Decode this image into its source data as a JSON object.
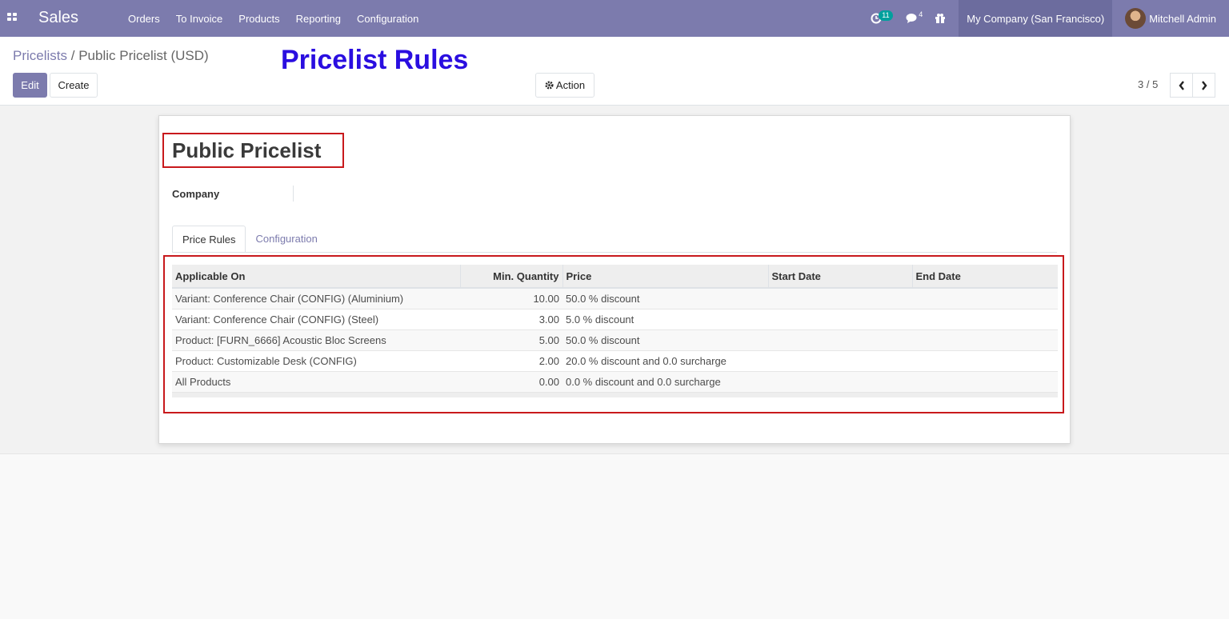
{
  "app": {
    "name": "Sales"
  },
  "menu": [
    "Orders",
    "To Invoice",
    "Products",
    "Reporting",
    "Configuration"
  ],
  "systray": {
    "activity_count": "11",
    "messages_count": "4",
    "company": "My Company (San Francisco)",
    "user": "Mitchell Admin"
  },
  "breadcrumb": {
    "parent": "Pricelists",
    "separator": "/",
    "current": "Public Pricelist (USD)"
  },
  "annotation": "Pricelist Rules",
  "buttons": {
    "edit": "Edit",
    "create": "Create",
    "action": "Action"
  },
  "pager": {
    "value": "3 / 5"
  },
  "form": {
    "title": "Public Pricelist",
    "company_label": "Company",
    "company_value": "",
    "tabs": [
      "Price Rules",
      "Configuration"
    ]
  },
  "table": {
    "headers": [
      "Applicable On",
      "Min. Quantity",
      "Price",
      "Start Date",
      "End Date"
    ],
    "rows": [
      [
        "Variant: Conference Chair (CONFIG) (Aluminium)",
        "10.00",
        "50.0 % discount",
        "",
        ""
      ],
      [
        "Variant: Conference Chair (CONFIG) (Steel)",
        "3.00",
        "5.0 % discount",
        "",
        ""
      ],
      [
        "Product: [FURN_6666] Acoustic Bloc Screens",
        "5.00",
        "50.0 % discount",
        "",
        ""
      ],
      [
        "Product: Customizable Desk (CONFIG)",
        "2.00",
        "20.0 % discount and 0.0 surcharge",
        "",
        ""
      ],
      [
        "All Products",
        "0.00",
        "0.0 % discount and 0.0 surcharge",
        "",
        ""
      ]
    ]
  },
  "colors": {
    "brand": "#7c7bad",
    "annotation": "#2a0ee0",
    "highlight_box": "#c8191c",
    "badge": "#00a09d"
  }
}
